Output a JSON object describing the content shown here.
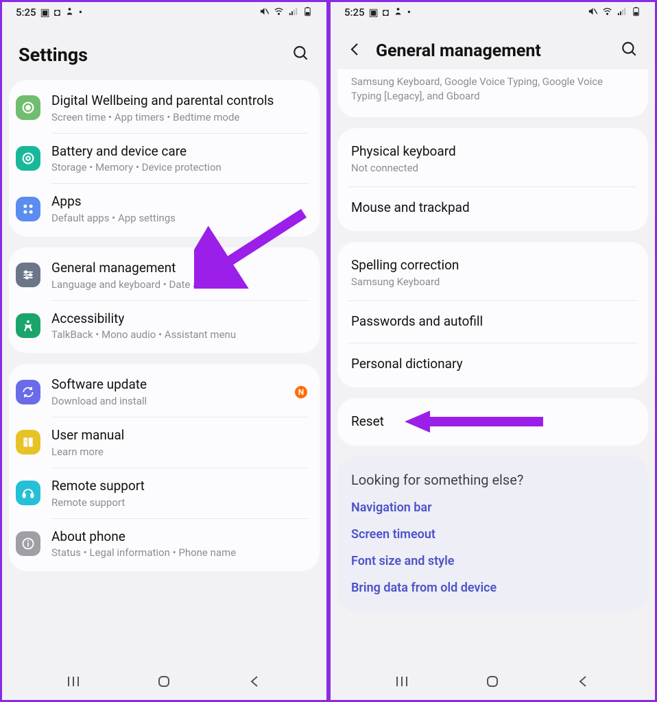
{
  "statusbar": {
    "time": "5:25"
  },
  "left": {
    "header": {
      "title": "Settings"
    },
    "group1": [
      {
        "icon": "wellbeing",
        "color": "#6fbd6f",
        "title": "Digital Wellbeing and parental controls",
        "sub": "Screen time  •  App timers  •  Bedtime mode"
      },
      {
        "icon": "battery",
        "color": "#18b89a",
        "title": "Battery and device care",
        "sub": "Storage  •  Memory  •  Device protection"
      },
      {
        "icon": "apps",
        "color": "#5b8cf0",
        "title": "Apps",
        "sub": "Default apps  •  App settings"
      }
    ],
    "group2": [
      {
        "icon": "general",
        "color": "#6c7689",
        "title": "General management",
        "sub": "Language and keyboard  •  Date and time"
      },
      {
        "icon": "accessibility",
        "color": "#19a56c",
        "title": "Accessibility",
        "sub": "TalkBack  •  Mono audio  •  Assistant menu"
      }
    ],
    "group3": [
      {
        "icon": "update",
        "color": "#6a6be8",
        "title": "Software update",
        "sub": "Download and install",
        "badge": "N"
      },
      {
        "icon": "manual",
        "color": "#e7c327",
        "title": "User manual",
        "sub": "Learn more"
      },
      {
        "icon": "remote",
        "color": "#24c0d6",
        "title": "Remote support",
        "sub": "Remote support"
      },
      {
        "icon": "about",
        "color": "#9f9fa6",
        "title": "About phone",
        "sub": "Status  •  Legal information  •  Phone name"
      }
    ]
  },
  "right": {
    "header": {
      "title": "General management"
    },
    "topsnippet": "Samsung Keyboard, Google Voice Typing, Google Voice Typing [Legacy], and Gboard",
    "group1": [
      {
        "title": "Physical keyboard",
        "sub": "Not connected"
      },
      {
        "title": "Mouse and trackpad"
      }
    ],
    "group2": [
      {
        "title": "Spelling correction",
        "sub": "Samsung Keyboard"
      },
      {
        "title": "Passwords and autofill"
      },
      {
        "title": "Personal dictionary"
      }
    ],
    "group3": [
      {
        "title": "Reset"
      }
    ],
    "suggest": {
      "heading": "Looking for something else?",
      "links": [
        "Navigation bar",
        "Screen timeout",
        "Font size and style",
        "Bring data from old device"
      ]
    }
  }
}
